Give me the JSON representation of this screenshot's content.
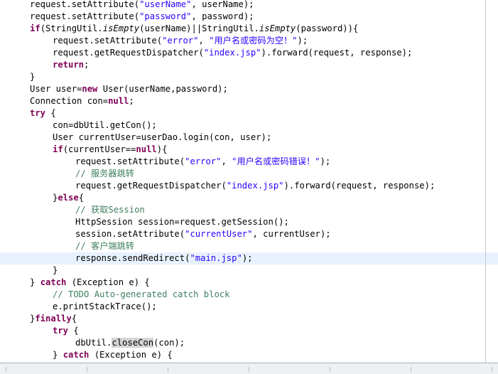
{
  "editor": {
    "lines": [
      {
        "indent": 1,
        "segments": [
          [
            "p",
            "request.setAttribute("
          ],
          [
            "s",
            "\"userName\""
          ],
          [
            "p",
            ", userName);"
          ]
        ]
      },
      {
        "indent": 1,
        "segments": [
          [
            "p",
            "request.setAttribute("
          ],
          [
            "s",
            "\"password\""
          ],
          [
            "p",
            ", password);"
          ]
        ]
      },
      {
        "indent": 1,
        "segments": [
          [
            "k",
            "if"
          ],
          [
            "p",
            "(StringUtil."
          ],
          [
            "i",
            "isEmpty"
          ],
          [
            "p",
            "(userName)||StringUtil."
          ],
          [
            "i",
            "isEmpty"
          ],
          [
            "p",
            "(password)){"
          ]
        ]
      },
      {
        "indent": 2,
        "segments": [
          [
            "p",
            "request.setAttribute("
          ],
          [
            "s",
            "\"error\""
          ],
          [
            "p",
            ", "
          ],
          [
            "s",
            "\"用户名或密码为空！\""
          ],
          [
            "p",
            ");"
          ]
        ]
      },
      {
        "indent": 2,
        "segments": [
          [
            "p",
            "request.getRequestDispatcher("
          ],
          [
            "s",
            "\"index.jsp\""
          ],
          [
            "p",
            ").forward(request, response);"
          ]
        ]
      },
      {
        "indent": 2,
        "segments": [
          [
            "k",
            "return"
          ],
          [
            "p",
            ";"
          ]
        ]
      },
      {
        "indent": 1,
        "segments": [
          [
            "p",
            "}"
          ]
        ]
      },
      {
        "indent": 1,
        "segments": [
          [
            "p",
            "User user="
          ],
          [
            "k",
            "new"
          ],
          [
            "p",
            " User(userName,password);"
          ]
        ]
      },
      {
        "indent": 1,
        "segments": [
          [
            "p",
            "Connection con="
          ],
          [
            "k",
            "null"
          ],
          [
            "p",
            ";"
          ]
        ]
      },
      {
        "indent": 1,
        "segments": [
          [
            "k",
            "try"
          ],
          [
            "p",
            " {"
          ]
        ]
      },
      {
        "indent": 2,
        "segments": [
          [
            "p",
            "con=dbUtil.getCon();"
          ]
        ]
      },
      {
        "indent": 2,
        "segments": [
          [
            "p",
            "User currentUser=userDao.login(con, user);"
          ]
        ]
      },
      {
        "indent": 2,
        "segments": [
          [
            "k",
            "if"
          ],
          [
            "p",
            "(currentUser=="
          ],
          [
            "k",
            "null"
          ],
          [
            "p",
            "){"
          ]
        ]
      },
      {
        "indent": 3,
        "segments": [
          [
            "p",
            "request.setAttribute("
          ],
          [
            "s",
            "\"error\""
          ],
          [
            "p",
            ", "
          ],
          [
            "s",
            "\"用户名或密码错误！\""
          ],
          [
            "p",
            ");"
          ]
        ]
      },
      {
        "indent": 3,
        "segments": [
          [
            "c",
            "// 服务器跳转"
          ]
        ]
      },
      {
        "indent": 3,
        "segments": [
          [
            "p",
            "request.getRequestDispatcher("
          ],
          [
            "s",
            "\"index.jsp\""
          ],
          [
            "p",
            ").forward(request, response);"
          ]
        ]
      },
      {
        "indent": 2,
        "segments": [
          [
            "p",
            "}"
          ],
          [
            "k",
            "else"
          ],
          [
            "p",
            "{"
          ]
        ]
      },
      {
        "indent": 3,
        "segments": [
          [
            "c",
            "// 获取Session"
          ]
        ]
      },
      {
        "indent": 3,
        "segments": [
          [
            "p",
            "HttpSession session=request.getSession();"
          ]
        ]
      },
      {
        "indent": 3,
        "segments": [
          [
            "p",
            "session.setAttribute("
          ],
          [
            "s",
            "\"currentUser\""
          ],
          [
            "p",
            ", currentUser);"
          ]
        ]
      },
      {
        "indent": 3,
        "segments": [
          [
            "c",
            "// 客户端跳转"
          ]
        ]
      },
      {
        "indent": 3,
        "current": true,
        "segments": [
          [
            "p",
            "response.sendRedirect("
          ],
          [
            "s",
            "\"main.jsp\""
          ],
          [
            "p",
            ");"
          ]
        ]
      },
      {
        "indent": 2,
        "segments": [
          [
            "p",
            "}"
          ]
        ]
      },
      {
        "indent": 1,
        "segments": [
          [
            "p",
            "} "
          ],
          [
            "k",
            "catch"
          ],
          [
            "p",
            " (Exception e) {"
          ]
        ]
      },
      {
        "indent": 2,
        "segments": [
          [
            "c",
            "// TODO Auto-generated catch block"
          ]
        ]
      },
      {
        "indent": 2,
        "segments": [
          [
            "p",
            "e.printStackTrace();"
          ]
        ]
      },
      {
        "indent": 1,
        "segments": [
          [
            "p",
            "}"
          ],
          [
            "k",
            "finally"
          ],
          [
            "p",
            "{"
          ]
        ]
      },
      {
        "indent": 2,
        "segments": [
          [
            "k",
            "try"
          ],
          [
            "p",
            " {"
          ]
        ]
      },
      {
        "indent": 3,
        "segments": [
          [
            "p",
            "dbUtil."
          ],
          [
            "o",
            "closeCon"
          ],
          [
            "p",
            "(con);"
          ]
        ]
      },
      {
        "indent": 2,
        "segments": [
          [
            "p",
            "} "
          ],
          [
            "k",
            "catch"
          ],
          [
            "p",
            " (Exception e) {"
          ]
        ]
      }
    ]
  }
}
